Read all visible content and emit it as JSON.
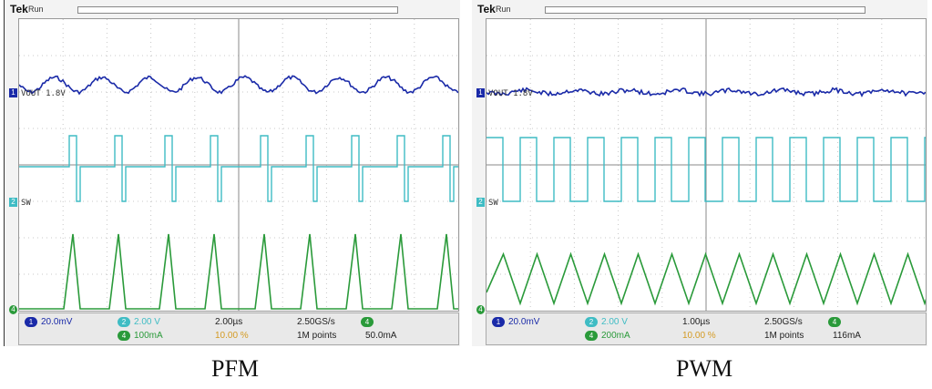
{
  "left": {
    "brand": "Tek",
    "run": "Run",
    "vout_label": "VOUT 1.8V",
    "sw_label": "SW",
    "ch1_scale": "20.0mV",
    "ch2_scale": "2.00 V",
    "ch4_scale": "100mA",
    "timebase": "2.00µs",
    "trigger_pct": "10.00 %",
    "sample_rate": "2.50GS/s",
    "record": "1M points",
    "trigger_level": "50.0mA",
    "caption": "PFM"
  },
  "right": {
    "brand": "Tek",
    "run": "Run",
    "vout_label": "VOUT 1.8V",
    "sw_label": "SW",
    "ch1_scale": "20.0mV",
    "ch2_scale": "2.00 V",
    "ch4_scale": "200mA",
    "timebase": "1.00µs",
    "trigger_pct": "10.00 %",
    "sample_rate": "2.50GS/s",
    "record": "1M points",
    "trigger_level": "116mA",
    "caption": "PWM"
  },
  "colors": {
    "ch1": "#1a2aa8",
    "ch2": "#3fbcc4",
    "ch4": "#2a9a3a"
  }
}
